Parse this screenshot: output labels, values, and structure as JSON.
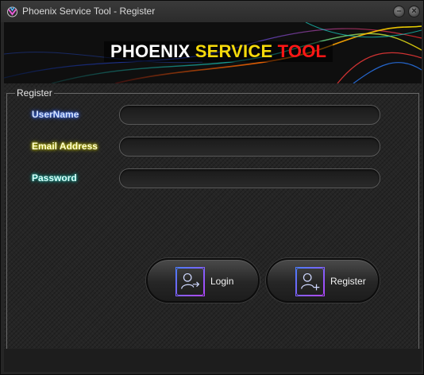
{
  "window": {
    "title": "Phoenix Service Tool - Register",
    "minimize_symbol": "–",
    "close_symbol": "×",
    "app_icon": "phoenix-logo-icon"
  },
  "banner": {
    "title_part1": "PHOENIX",
    "title_part2": "SERVICE",
    "title_part3": "TOOL",
    "colors": {
      "part1": "#ffffff",
      "part2": "#f5d90a",
      "part3": "#ff1616"
    }
  },
  "form": {
    "group_label": "Register",
    "fields": {
      "username_label": "UserName",
      "email_label": "Email Address",
      "password_label": "Password",
      "username_value": "",
      "email_value": "",
      "password_value": ""
    }
  },
  "buttons": {
    "login_label": "Login",
    "login_icon": "user-arrow-right-icon",
    "register_label": "Register",
    "register_icon": "user-plus-icon"
  }
}
